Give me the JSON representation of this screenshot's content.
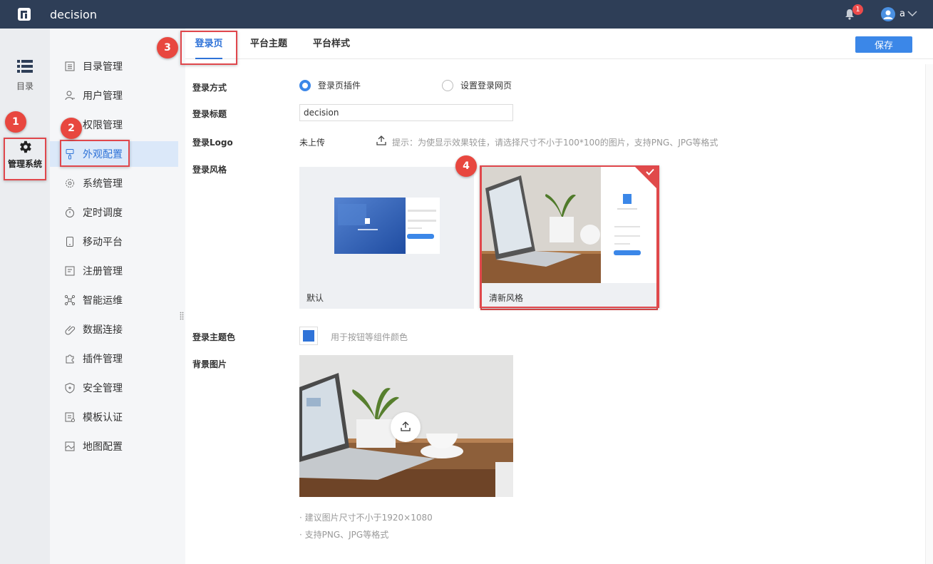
{
  "header": {
    "app_title": "decision",
    "notification_count": "1",
    "user_name": "a"
  },
  "rail": {
    "directory_label": "目录",
    "system_label": "管理系统"
  },
  "menu": {
    "items": [
      {
        "label": "目录管理",
        "icon": "list-icon"
      },
      {
        "label": "用户管理",
        "icon": "user-icon"
      },
      {
        "label": "权限管理",
        "icon": "permission-icon"
      },
      {
        "label": "外观配置",
        "icon": "brush-icon"
      },
      {
        "label": "系统管理",
        "icon": "gear-icon"
      },
      {
        "label": "定时调度",
        "icon": "timer-icon"
      },
      {
        "label": "移动平台",
        "icon": "mobile-icon"
      },
      {
        "label": "注册管理",
        "icon": "register-icon"
      },
      {
        "label": "智能运维",
        "icon": "network-icon"
      },
      {
        "label": "数据连接",
        "icon": "link-icon"
      },
      {
        "label": "插件管理",
        "icon": "plugin-icon"
      },
      {
        "label": "安全管理",
        "icon": "shield-icon"
      },
      {
        "label": "模板认证",
        "icon": "template-icon"
      },
      {
        "label": "地图配置",
        "icon": "map-icon"
      }
    ],
    "active": "外观配置"
  },
  "tabs": [
    {
      "label": "登录页"
    },
    {
      "label": "平台主题"
    },
    {
      "label": "平台样式"
    }
  ],
  "toolbar": {
    "save_label": "保存"
  },
  "form": {
    "login_method": {
      "label": "登录方式",
      "options": [
        "登录页插件",
        "设置登录网页"
      ],
      "selected": "登录页插件"
    },
    "login_title": {
      "label": "登录标题",
      "value": "decision"
    },
    "login_logo": {
      "label": "登录Logo",
      "status": "未上传",
      "hint": "提示：为使显示效果较佳，请选择尺寸不小于100*100的图片，支持PNG、JPG等格式"
    },
    "login_style": {
      "label": "登录风格",
      "options": [
        "默认",
        "清新风格"
      ],
      "selected": "清新风格"
    },
    "theme_color": {
      "label": "登录主题色",
      "color": "#2f73d8",
      "hint": "用于按钮等组件颜色"
    },
    "background": {
      "label": "背景图片",
      "notes": [
        "· 建议图片尺寸不小于1920×1080",
        "· 支持PNG、JPG等格式"
      ]
    }
  },
  "callouts": [
    "1",
    "2",
    "3",
    "4"
  ],
  "colors": {
    "header_bg": "#2e3e57",
    "accent": "#3b87e8",
    "highlight": "#e0474c"
  }
}
